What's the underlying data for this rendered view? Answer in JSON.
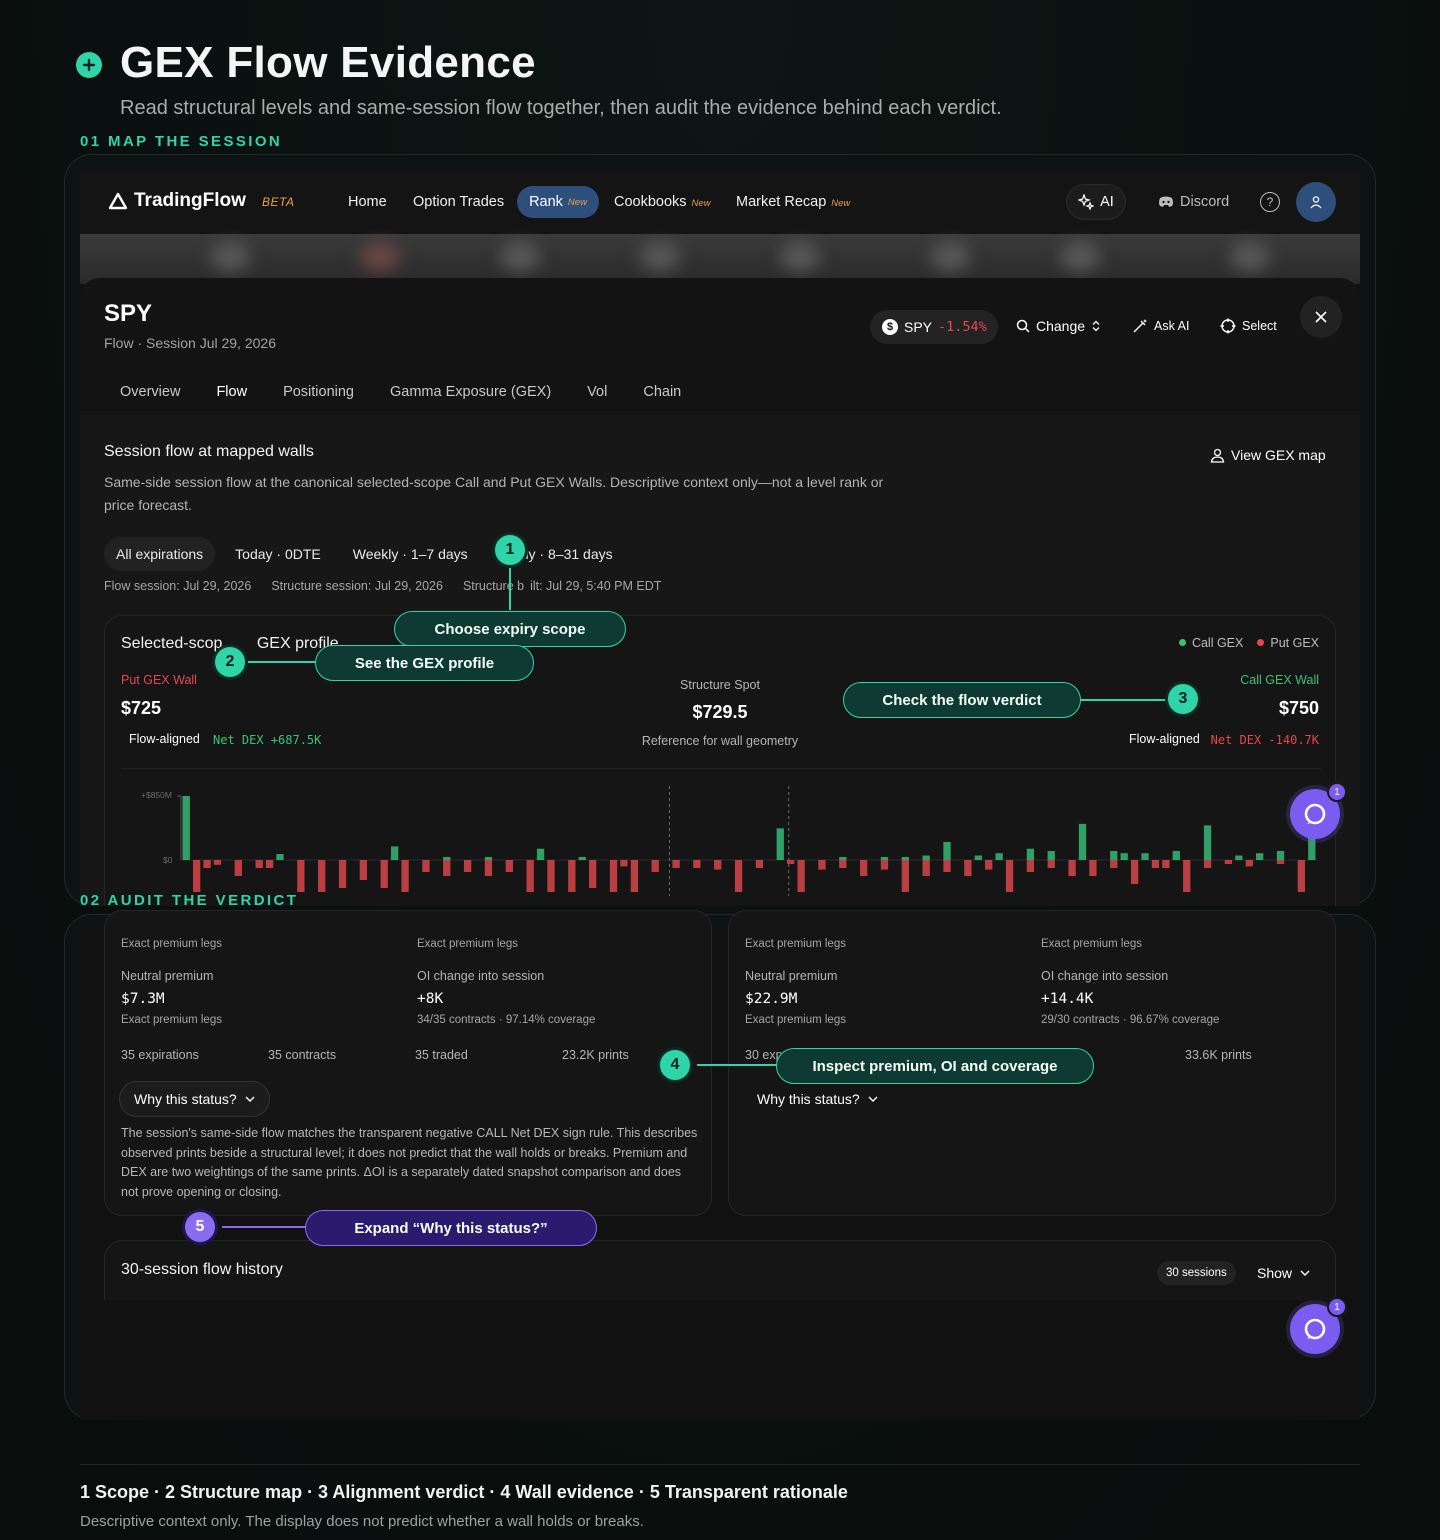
{
  "header": {
    "title": "GEX Flow Evidence",
    "subtitle": "Read structural levels and same-session flow together, then audit the evidence behind each verdict."
  },
  "steps": {
    "map": "01 MAP THE SESSION",
    "audit": "02 AUDIT THE VERDICT"
  },
  "nav": {
    "brand": "TradingFlow",
    "beta": "BETA",
    "links": [
      "Home",
      "Option Trades",
      "Rank",
      "Cookbooks",
      "Market Recap"
    ],
    "new_tag": "New",
    "ai": "AI",
    "discord": "Discord",
    "help": "?"
  },
  "symbol": {
    "ticker": "SPY",
    "subtitle": "Flow · Session Jul 29, 2026",
    "chip_ticker": "SPY",
    "chip_change": "-1.54%",
    "change": "Change",
    "ask_ai": "Ask AI",
    "select": "Select"
  },
  "tabs": [
    "Overview",
    "Flow",
    "Positioning",
    "Gamma Exposure (GEX)",
    "Vol",
    "Chain"
  ],
  "flow_section": {
    "title": "Session flow at mapped walls",
    "description": "Same-side session flow at the canonical selected-scope Call and Put GEX Walls. Descriptive context only—not a level rank or price forecast.",
    "view_map": "View GEX map",
    "scopes": [
      "All expirations",
      "Today · 0DTE",
      "Weekly · 1–7 days",
      "hly · 8–31 days"
    ],
    "meta": {
      "flow_session": "Flow session: Jul 29, 2026",
      "structure_session": "Structure session: Jul 29, 2026",
      "structure_built_a": "Structure b",
      "structure_built_b": "ilt: Jul 29, 5:40 PM EDT"
    }
  },
  "gex_profile": {
    "title_a": "Selected-scop",
    "title_b": " GEX profile",
    "legend_call": "Call GEX",
    "legend_put": "Put GEX",
    "put_wall_label": "Put GEX Wall",
    "put_wall_value": "$725",
    "put_verdict": "Flow-aligned",
    "put_dex": "Net DEX +687.5K",
    "spot_label": "Structure Spot",
    "spot_value": "$729.5",
    "spot_note": "Reference for wall geometry",
    "call_wall_label": "Call GEX Wall",
    "call_wall_value": "$750",
    "call_verdict": "Flow-aligned",
    "call_dex": "Net DEX -140.7K",
    "axis_top": "+$850M",
    "axis_zero": "$0"
  },
  "chart_data": {
    "type": "bar",
    "series": [
      {
        "name": "Call GEX",
        "values": [
          850,
          0,
          0,
          0,
          0,
          0,
          0,
          0,
          0,
          80,
          0,
          0,
          0,
          0,
          0,
          0,
          0,
          0,
          0,
          0,
          180,
          0,
          0,
          0,
          0,
          40,
          0,
          0,
          0,
          40,
          0,
          0,
          0,
          0,
          150,
          0,
          0,
          0,
          40,
          0,
          0,
          0,
          0,
          0,
          0,
          0,
          0,
          0,
          0,
          0,
          0,
          0,
          0,
          0,
          0,
          0,
          0,
          420,
          0,
          0,
          0,
          0,
          0,
          40,
          0,
          0,
          0,
          40,
          0,
          40,
          0,
          60,
          0,
          240,
          0,
          0,
          60,
          0,
          90,
          0,
          0,
          150,
          0,
          120,
          0,
          0,
          480,
          0,
          0,
          120,
          90,
          0,
          90,
          0,
          0,
          120,
          0,
          0,
          460,
          0,
          0,
          60,
          0,
          90,
          0,
          120,
          0,
          0,
          400
        ]
      },
      {
        "name": "Put GEX",
        "values": [
          0,
          -400,
          -100,
          -60,
          0,
          -200,
          0,
          -100,
          -100,
          0,
          0,
          -400,
          0,
          -400,
          0,
          -350,
          0,
          -250,
          0,
          -350,
          0,
          -400,
          0,
          -150,
          0,
          -200,
          0,
          -150,
          0,
          -200,
          0,
          -150,
          0,
          -400,
          0,
          -400,
          0,
          -400,
          0,
          -350,
          0,
          -400,
          -80,
          -400,
          0,
          -150,
          0,
          -100,
          0,
          -100,
          0,
          -120,
          0,
          -400,
          0,
          -100,
          0,
          0,
          -50,
          -400,
          0,
          -120,
          0,
          -100,
          0,
          -200,
          0,
          -120,
          0,
          -400,
          0,
          -200,
          0,
          -150,
          0,
          -200,
          0,
          -120,
          0,
          -400,
          0,
          -150,
          0,
          -100,
          0,
          -200,
          0,
          -200,
          0,
          -100,
          0,
          -300,
          0,
          -100,
          -100,
          0,
          -400,
          0,
          -100,
          0,
          -50,
          0,
          -80,
          0,
          0,
          -50,
          0,
          -400
        ]
      }
    ],
    "ylim": [
      -450,
      850
    ],
    "markers": [
      "Put GEX Wall",
      "Structure Spot"
    ]
  },
  "audit": {
    "left": {
      "legs_1": "Exact premium legs",
      "legs_2": "Exact premium legs",
      "premium_label": "Neutral premium",
      "premium_value": "$7.3M",
      "premium_sub": "Exact premium legs",
      "oi_label": "OI change into session",
      "oi_value": "+8K",
      "oi_sub": "34/35 contracts · 97.14% coverage",
      "stats": [
        "35 expirations",
        "35 contracts",
        "35 traded",
        "23.2K prints"
      ],
      "why": "Why this status?",
      "rationale": "The session's same-side flow matches the transparent negative CALL Net DEX sign rule. This describes observed prints beside a structural level; it does not predict that the wall holds or breaks. Premium and DEX are two weightings of the same prints. ΔOI is a separately dated snapshot comparison and does not prove opening or closing."
    },
    "right": {
      "legs_1": "Exact premium legs",
      "legs_2": "Exact premium legs",
      "premium_label": "Neutral premium",
      "premium_value": "$22.9M",
      "premium_sub": "Exact premium legs",
      "oi_label": "OI change into session",
      "oi_value": "+14.4K",
      "oi_sub": "29/30 contracts · 96.67% coverage",
      "stat_first": "30 exp",
      "stat_last": "33.6K prints",
      "why": "Why this status?"
    },
    "history_title": "30-session flow history",
    "history_sessions": "30 sessions",
    "history_show": "Show"
  },
  "callouts": {
    "c1": "Choose expiry scope",
    "c2": "See the GEX profile",
    "c3": "Check the flow verdict",
    "c4": "Inspect premium, OI and coverage",
    "c5": "Expand “Why this status?”",
    "n1": "1",
    "n2": "2",
    "n3": "3",
    "n4": "4",
    "n5": "5"
  },
  "fab_count": "1",
  "footer": {
    "title": "1 Scope · 2 Structure map · 3 Alignment verdict · 4 Wall evidence · 5 Transparent rationale",
    "note": "Descriptive context only. The display does not predict whether a wall holds or breaks."
  },
  "colors": {
    "accent": "#2fd4a8",
    "call": "#37c47a",
    "put": "#e5484d",
    "callout_purple": "#8b6cf0"
  }
}
